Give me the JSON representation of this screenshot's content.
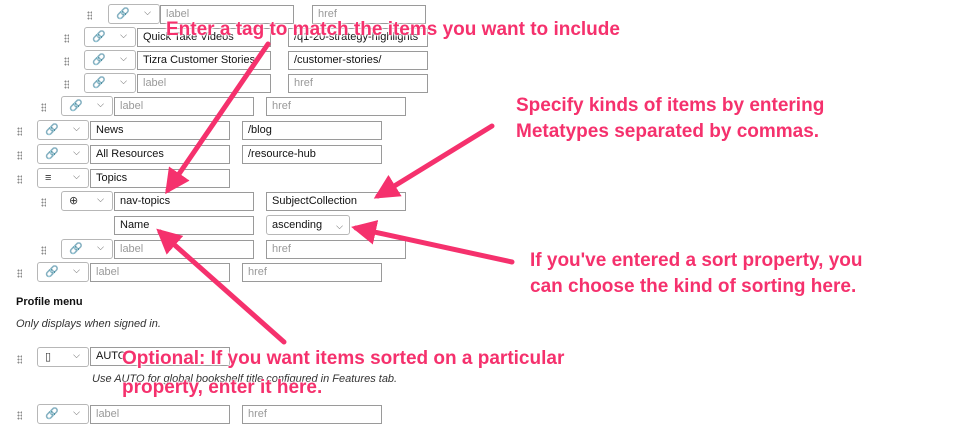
{
  "menu_rows": [
    {
      "icon": "link-icon",
      "label": "",
      "label_placeholder": "label",
      "href": "",
      "href_placeholder": "href"
    },
    {
      "icon": "link-icon",
      "label": "Quick Take Videos",
      "href": "/q1-20-strategy-highlights"
    },
    {
      "icon": "link-icon",
      "label": "Tizra Customer Stories",
      "href": "/customer-stories/"
    },
    {
      "icon": "link-icon",
      "label": "",
      "label_placeholder": "label",
      "href": "",
      "href_placeholder": "href"
    },
    {
      "icon": "link-icon",
      "label": "",
      "label_placeholder": "label",
      "href": "",
      "href_placeholder": "href"
    },
    {
      "icon": "link-icon",
      "label": "News",
      "href": "/blog"
    },
    {
      "icon": "link-icon",
      "label": "All Resources",
      "href": "/resource-hub"
    },
    {
      "icon": "list-icon",
      "label": "Topics"
    },
    {
      "icon": "globe-icon",
      "label": "nav-topics",
      "metatypes": "SubjectCollection"
    },
    {
      "sort_property": "Name",
      "sort_order": "ascending"
    },
    {
      "icon": "link-icon",
      "label": "",
      "label_placeholder": "label",
      "href": "",
      "href_placeholder": "href"
    },
    {
      "icon": "link-icon",
      "label": "",
      "label_placeholder": "label",
      "href": "",
      "href_placeholder": "href"
    }
  ],
  "profile_menu": {
    "heading": "Profile menu",
    "note": "Only displays when signed in.",
    "bookshelf_row": {
      "icon": "book-icon",
      "label": "AUTO"
    },
    "auto_note": "Use AUTO for global bookshelf title configured in Features tab.",
    "last_row": {
      "icon": "link-icon",
      "label": "",
      "label_placeholder": "label",
      "href": "",
      "href_placeholder": "href"
    }
  },
  "callouts": {
    "tag": "Enter a tag to match the items you want to include",
    "metatypes_line1": "Specify kinds of items by entering",
    "metatypes_line2": "Metatypes separated by commas.",
    "sort_line1": "If you've entered a sort property, you",
    "sort_line2": "can choose the kind of sorting here.",
    "optional_line1": "Optional: If you want items sorted on a particular",
    "optional_line2": "property, enter it here."
  },
  "colors": {
    "callout": "#f5316d",
    "border": "#9a9a9a"
  }
}
